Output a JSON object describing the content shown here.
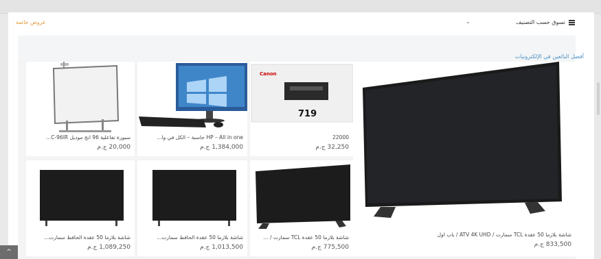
{
  "nav": {
    "offers_label": "عروض خاصة",
    "shop_by_category": "تسوق حسب التصنيف",
    "menu_icon": "hamburger-icon",
    "dropdown_icon": "chevron-down-icon"
  },
  "section": {
    "title": "أفضل البائعين في الإلكترونيات"
  },
  "products": [
    {
      "name": "شاشة بلازما 50 عقدة TCL سمارت / ATV 4K UHD / باب اول",
      "price": "833,500 ج.م"
    },
    {
      "name": "22000",
      "price": "32,250 ج.م"
    },
    {
      "name": "HP – All in one حاسبة – الكل في وا...",
      "price": "1,384,000 ج.م"
    },
    {
      "name": "سبورة تفاعلية 96 انج موديل C-96IR...",
      "price": "20,000 ج.م"
    },
    {
      "name": "شاشة بلازما 50 عقدة TCL سمارت / ...",
      "price": "775,500 ج.م"
    },
    {
      "name": "شاشة بلازما 50 عقدة الحافظ سمارت...",
      "price": "1,013,500 ج.م"
    },
    {
      "name": "شاشة بلازما 50 عقدة الحافظ سمارت...",
      "price": "1,089,250 ج.م"
    }
  ],
  "toner_box": {
    "brand": "Canon",
    "model": "719"
  },
  "scroll_up_icon": "chevron-up-icon",
  "colors": {
    "accent_orange": "#e09a3a",
    "link_blue": "#4a90c8",
    "scroll_button": "#6d6d6d"
  }
}
